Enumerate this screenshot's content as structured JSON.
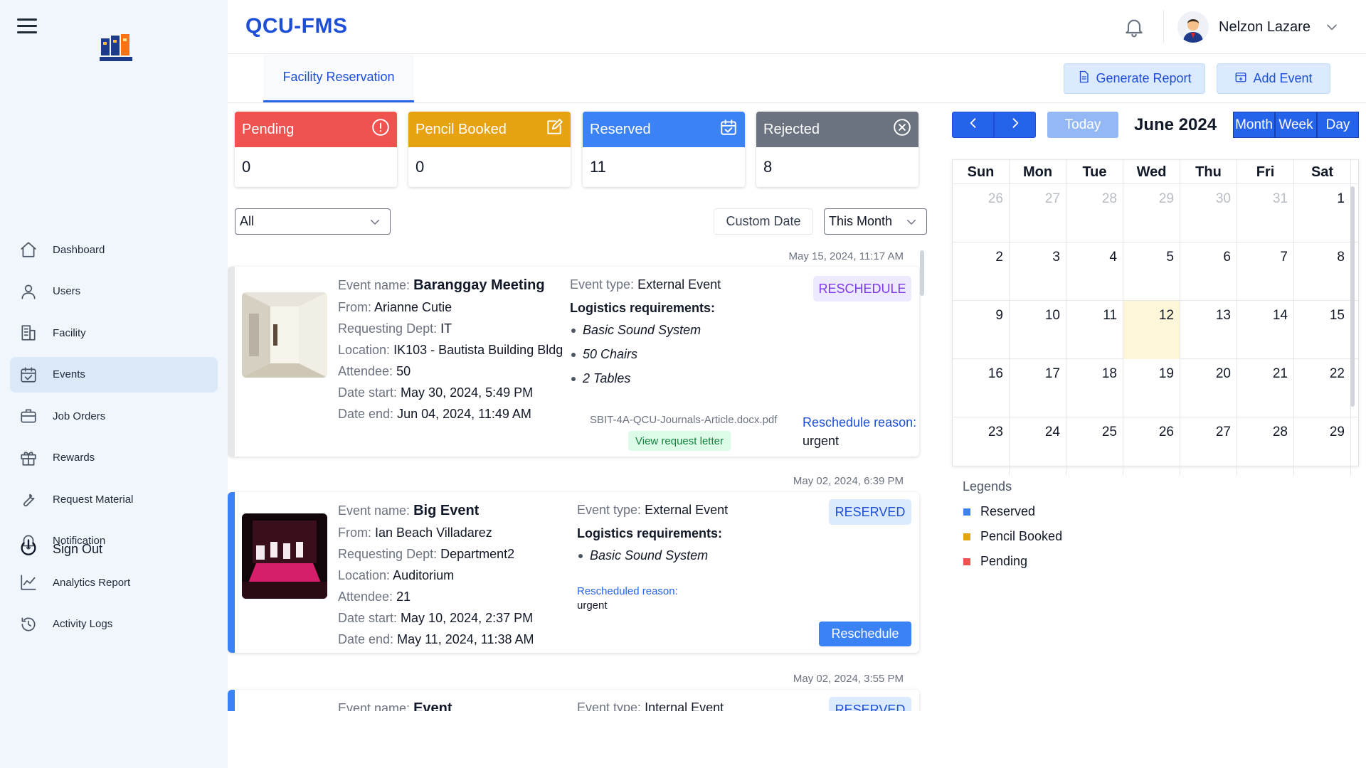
{
  "app": {
    "title": "QCU-FMS"
  },
  "sidebar": {
    "logo_label": "QCU-FMS",
    "items": [
      {
        "label": "Dashboard",
        "icon": "home-icon"
      },
      {
        "label": "Users",
        "icon": "user-icon"
      },
      {
        "label": "Facility",
        "icon": "building-icon"
      },
      {
        "label": "Events",
        "icon": "calendar-check-icon",
        "active": true
      },
      {
        "label": "Job Orders",
        "icon": "briefcase-icon"
      },
      {
        "label": "Rewards",
        "icon": "gift-icon"
      },
      {
        "label": "Request Material",
        "icon": "wrench-icon"
      },
      {
        "label": "Notification",
        "icon": "bell-icon"
      },
      {
        "label": "Analytics Report",
        "icon": "chart-line-icon"
      },
      {
        "label": "Activity Logs",
        "icon": "history-icon"
      }
    ],
    "signout_label": "Sign Out"
  },
  "header": {
    "user_name": "Nelzon Lazare"
  },
  "tabs": {
    "active_label": "Facility Reservation"
  },
  "actions": {
    "generate_report": "Generate Report",
    "add_event": "Add Event"
  },
  "stats": {
    "pending": {
      "label": "Pending",
      "value": "0",
      "color": "#ef5350"
    },
    "pencil": {
      "label": "Pencil Booked",
      "value": "0",
      "color": "#e6a210"
    },
    "reserved": {
      "label": "Reserved",
      "value": "11",
      "color": "#3b82f6"
    },
    "rejected": {
      "label": "Rejected",
      "value": "8",
      "color": "#6b7280"
    }
  },
  "filters": {
    "status": "All",
    "custom_date": "Custom Date",
    "range": "This Month"
  },
  "events": [
    {
      "timestamp": "May 15, 2024, 11:17 AM",
      "name_label": "Event name:",
      "name": "Baranggay Meeting",
      "from_label": "From:",
      "from": "Arianne Cutie",
      "dept_label": "Requesting Dept:",
      "dept": "IT",
      "loc_label": "Location:",
      "loc": "IK103 - Bautista Building Bldg",
      "att_label": "Attendee:",
      "att": "50",
      "start_label": "Date start:",
      "start": "May 30, 2024, 5:49 PM",
      "end_label": "Date end:",
      "end": "Jun 04, 2024, 11:49 AM",
      "type_label": "Event type:",
      "type": "External Event",
      "logistics_label": "Logistics requirements:",
      "logistics": [
        "Basic Sound System",
        "50 Chairs",
        "2 Tables"
      ],
      "status": "RESCHEDULE",
      "file": "SBIT-4A-QCU-Journals-Article.docx.pdf",
      "view_letter": "View request letter",
      "reason_label": "Reschedule reason:",
      "reason": "urgent"
    },
    {
      "timestamp": "May 02, 2024, 6:39 PM",
      "name_label": "Event name:",
      "name": "Big Event",
      "from_label": "From:",
      "from": "Ian Beach Villadarez",
      "dept_label": "Requesting Dept:",
      "dept": "Department2",
      "loc_label": "Location:",
      "loc": "Auditorium",
      "att_label": "Attendee:",
      "att": "21",
      "start_label": "Date start:",
      "start": "May 10, 2024, 2:37 PM",
      "end_label": "Date end:",
      "end": "May 11, 2024, 11:38 AM",
      "type_label": "Event type:",
      "type": "External Event",
      "logistics_label": "Logistics requirements:",
      "logistics": [
        "Basic Sound System"
      ],
      "reason_label": "Rescheduled reason:",
      "reason": "urgent",
      "status": "RESERVED",
      "action": "Reschedule"
    },
    {
      "timestamp": "May 02, 2024, 3:55 PM",
      "name_label": "Event name:",
      "name": "Event",
      "type_label": "Event type:",
      "type": "Internal Event",
      "status": "RESERVED"
    }
  ],
  "calendar": {
    "title": "June 2024",
    "today_label": "Today",
    "views": [
      "Month",
      "Week",
      "Day"
    ],
    "weekdays": [
      "Sun",
      "Mon",
      "Tue",
      "Wed",
      "Thu",
      "Fri",
      "Sat"
    ],
    "weeks": [
      [
        "26",
        "27",
        "28",
        "29",
        "30",
        "31",
        "1"
      ],
      [
        "2",
        "3",
        "4",
        "5",
        "6",
        "7",
        "8"
      ],
      [
        "9",
        "10",
        "11",
        "12",
        "13",
        "14",
        "15"
      ],
      [
        "16",
        "17",
        "18",
        "19",
        "20",
        "21",
        "22"
      ],
      [
        "23",
        "24",
        "25",
        "26",
        "27",
        "28",
        "29"
      ]
    ]
  },
  "legends": {
    "title": "Legends",
    "items": [
      {
        "label": "Reserved",
        "color": "#3b82f6"
      },
      {
        "label": "Pencil Booked",
        "color": "#e6a210"
      },
      {
        "label": "Pending",
        "color": "#ef5350"
      }
    ]
  }
}
